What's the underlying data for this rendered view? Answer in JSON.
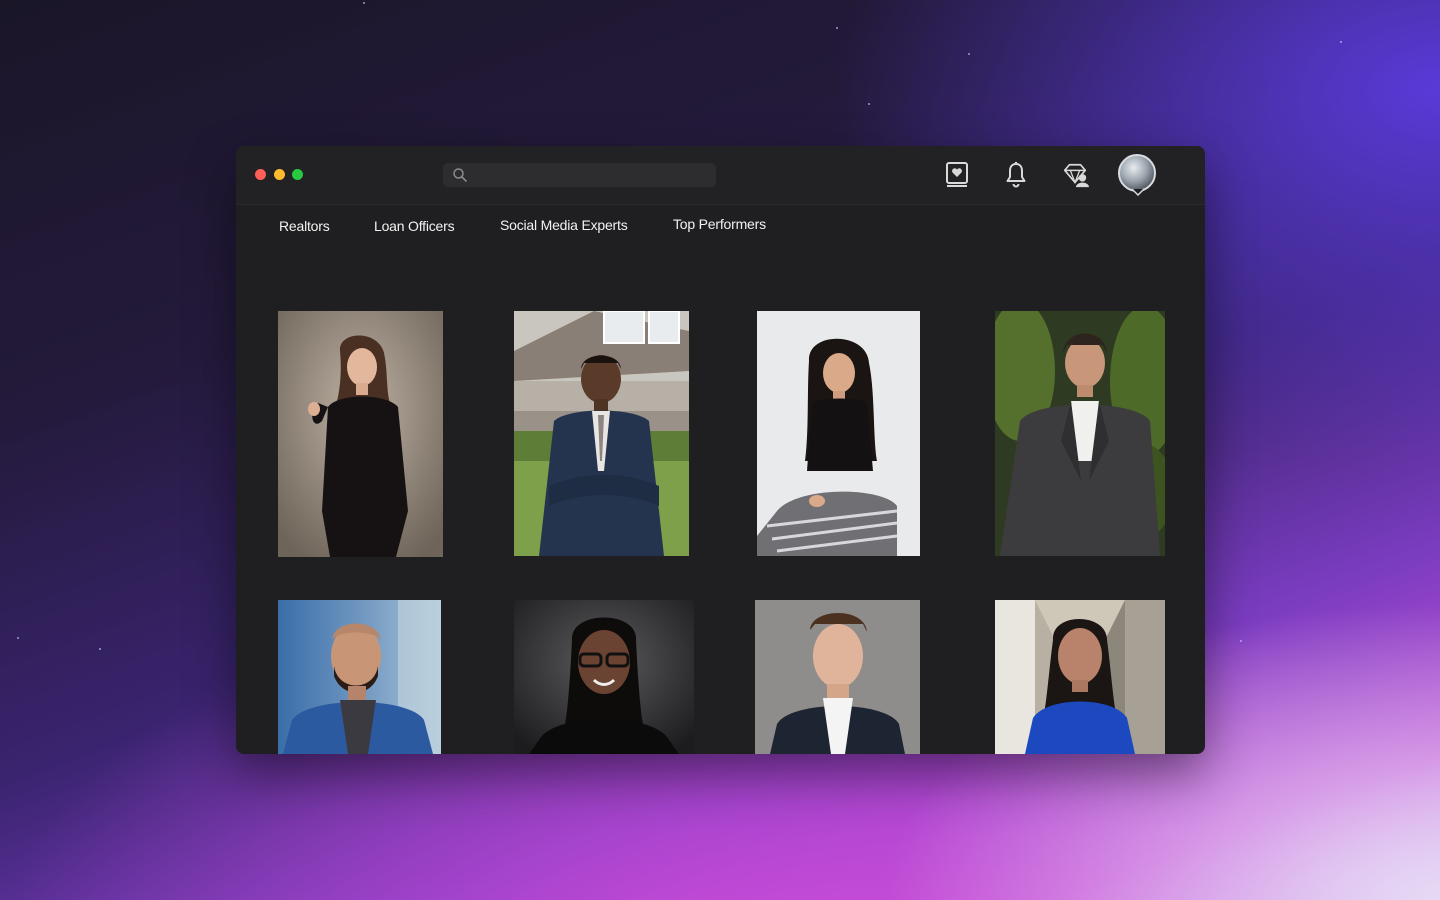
{
  "window": {
    "traffic_lights": [
      "close",
      "minimize",
      "zoom"
    ],
    "search": {
      "placeholder": "",
      "value": ""
    },
    "toolbar_icons": [
      "saved-profiles-icon",
      "bell-icon",
      "badge-gem-icon",
      "avatar"
    ]
  },
  "nav": {
    "tabs": [
      {
        "label": "Realtors"
      },
      {
        "label": "Loan Officers"
      },
      {
        "label": "Social Media Experts"
      },
      {
        "label": "Top Performers"
      }
    ]
  },
  "gallery": {
    "rows": [
      [
        {
          "subject": "woman-black-outfit-portrait"
        },
        {
          "subject": "man-blue-suit-house-portrait"
        },
        {
          "subject": "woman-black-top-seated-portrait"
        },
        {
          "subject": "man-gray-blazer-plants-portrait"
        }
      ],
      [
        {
          "subject": "bald-man-blue-blazer-portrait"
        },
        {
          "subject": "woman-glasses-dark-portrait"
        },
        {
          "subject": "young-man-dark-suit-portrait"
        },
        {
          "subject": "woman-blue-top-street-portrait"
        }
      ]
    ]
  },
  "colors": {
    "window_bg": "#1f1e20",
    "titlebar_bg": "#222123",
    "text": "#f2f2f2",
    "close": "#fe5f57",
    "minimize": "#febc2e",
    "zoom": "#28c840"
  }
}
